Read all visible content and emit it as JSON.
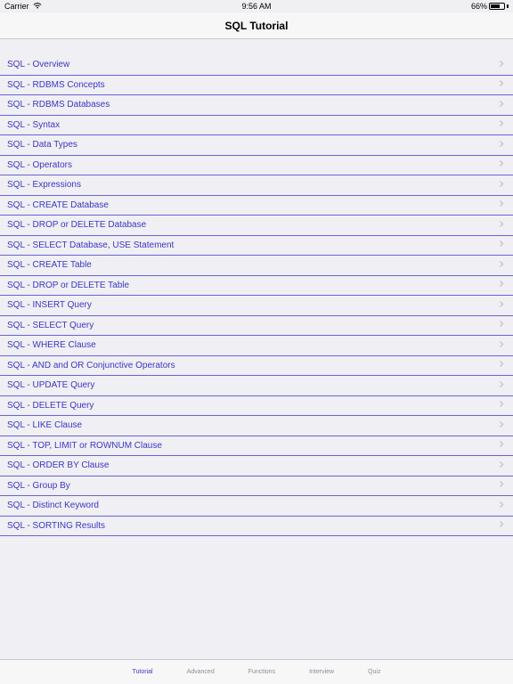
{
  "status": {
    "carrier": "Carrier",
    "time": "9:56 AM",
    "battery_pct": "66%"
  },
  "nav": {
    "title": "SQL Tutorial"
  },
  "list": {
    "items": [
      {
        "label": "SQL - Overview"
      },
      {
        "label": "SQL - RDBMS Concepts"
      },
      {
        "label": "SQL - RDBMS Databases"
      },
      {
        "label": "SQL - Syntax"
      },
      {
        "label": "SQL - Data Types"
      },
      {
        "label": "SQL - Operators"
      },
      {
        "label": "SQL - Expressions"
      },
      {
        "label": "SQL - CREATE Database"
      },
      {
        "label": "SQL - DROP or DELETE Database"
      },
      {
        "label": "SQL - SELECT Database, USE Statement"
      },
      {
        "label": "SQL - CREATE Table"
      },
      {
        "label": "SQL - DROP or DELETE Table"
      },
      {
        "label": "SQL - INSERT Query"
      },
      {
        "label": "SQL - SELECT Query"
      },
      {
        "label": "SQL - WHERE Clause"
      },
      {
        "label": "SQL - AND and OR Conjunctive Operators"
      },
      {
        "label": "SQL - UPDATE Query"
      },
      {
        "label": "SQL - DELETE Query"
      },
      {
        "label": "SQL - LIKE Clause"
      },
      {
        "label": "SQL - TOP, LIMIT or ROWNUM Clause"
      },
      {
        "label": "SQL - ORDER BY Clause"
      },
      {
        "label": "SQL - Group By"
      },
      {
        "label": "SQL - Distinct Keyword"
      },
      {
        "label": "SQL - SORTING Results"
      }
    ]
  },
  "tabs": [
    {
      "label": "Tutorial",
      "active": true
    },
    {
      "label": "Advanced",
      "active": false
    },
    {
      "label": "Functions",
      "active": false
    },
    {
      "label": "Interview",
      "active": false
    },
    {
      "label": "Quiz",
      "active": false
    }
  ]
}
